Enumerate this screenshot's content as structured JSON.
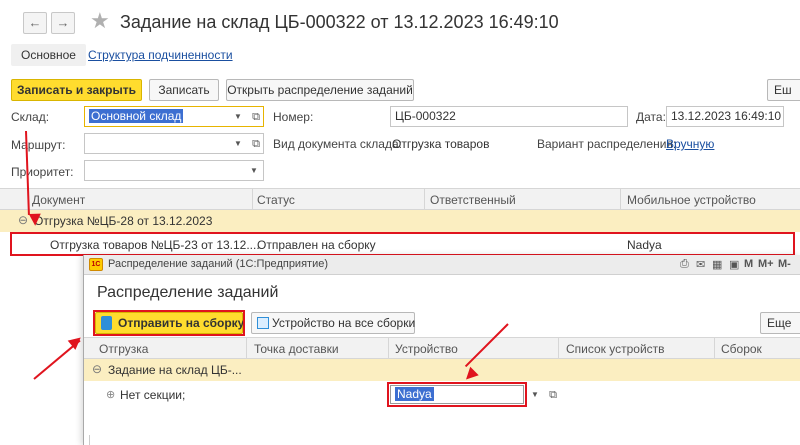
{
  "header": {
    "back_glyph": "←",
    "forward_glyph": "→",
    "star_glyph": "★",
    "title": "Задание на склад ЦБ-000322 от 13.12.2023 16:49:10"
  },
  "tabs": {
    "main": "Основное",
    "structure": "Структура подчиненности"
  },
  "toolbar": {
    "save_close": "Записать и закрыть",
    "save": "Записать",
    "open_distribution": "Открыть распределение заданий",
    "more": "Еш"
  },
  "form": {
    "warehouse_label": "Склад:",
    "warehouse_value": "Основной склад",
    "route_label": "Маршрут:",
    "route_value": "",
    "priority_label": "Приоритет:",
    "priority_value": "",
    "number_label": "Номер:",
    "number_value": "ЦБ-000322",
    "date_label": "Дата:",
    "date_value": "13.12.2023 16:49:10",
    "doc_type_label": "Вид документа склада:",
    "doc_type_value": "Отгрузка товаров",
    "variant_label": "Вариант распределения:",
    "variant_value": "Вручную"
  },
  "grid": {
    "columns": [
      "Документ",
      "Статус",
      "Ответственный",
      "Мобильное устройство"
    ],
    "group_row": "Отгрузка №ЦБ-28 от 13.12.2023",
    "rows": [
      {
        "document": "Отгрузка товаров №ЦБ-23 от 13.12....",
        "status": "Отправлен на сборку",
        "responsible": "",
        "device": "Nadya"
      }
    ]
  },
  "subwindow": {
    "window_title": "Распределение заданий (1С:Предприятие)",
    "app_icon_text": "1С",
    "heading": "Распределение заданий",
    "send_button": "Отправить на сборку",
    "device_all_button": "Устройство на все сборки",
    "more": "Еще",
    "columns": [
      "Отгрузка",
      "Точка доставки",
      "Устройство",
      "Список устройств",
      "Сборок"
    ],
    "group_row": "Задание на склад ЦБ-...",
    "row_label": "Нет секции;",
    "device_value": "Nadya",
    "titlebar_icons": [
      "M",
      "M+",
      "M-"
    ]
  }
}
